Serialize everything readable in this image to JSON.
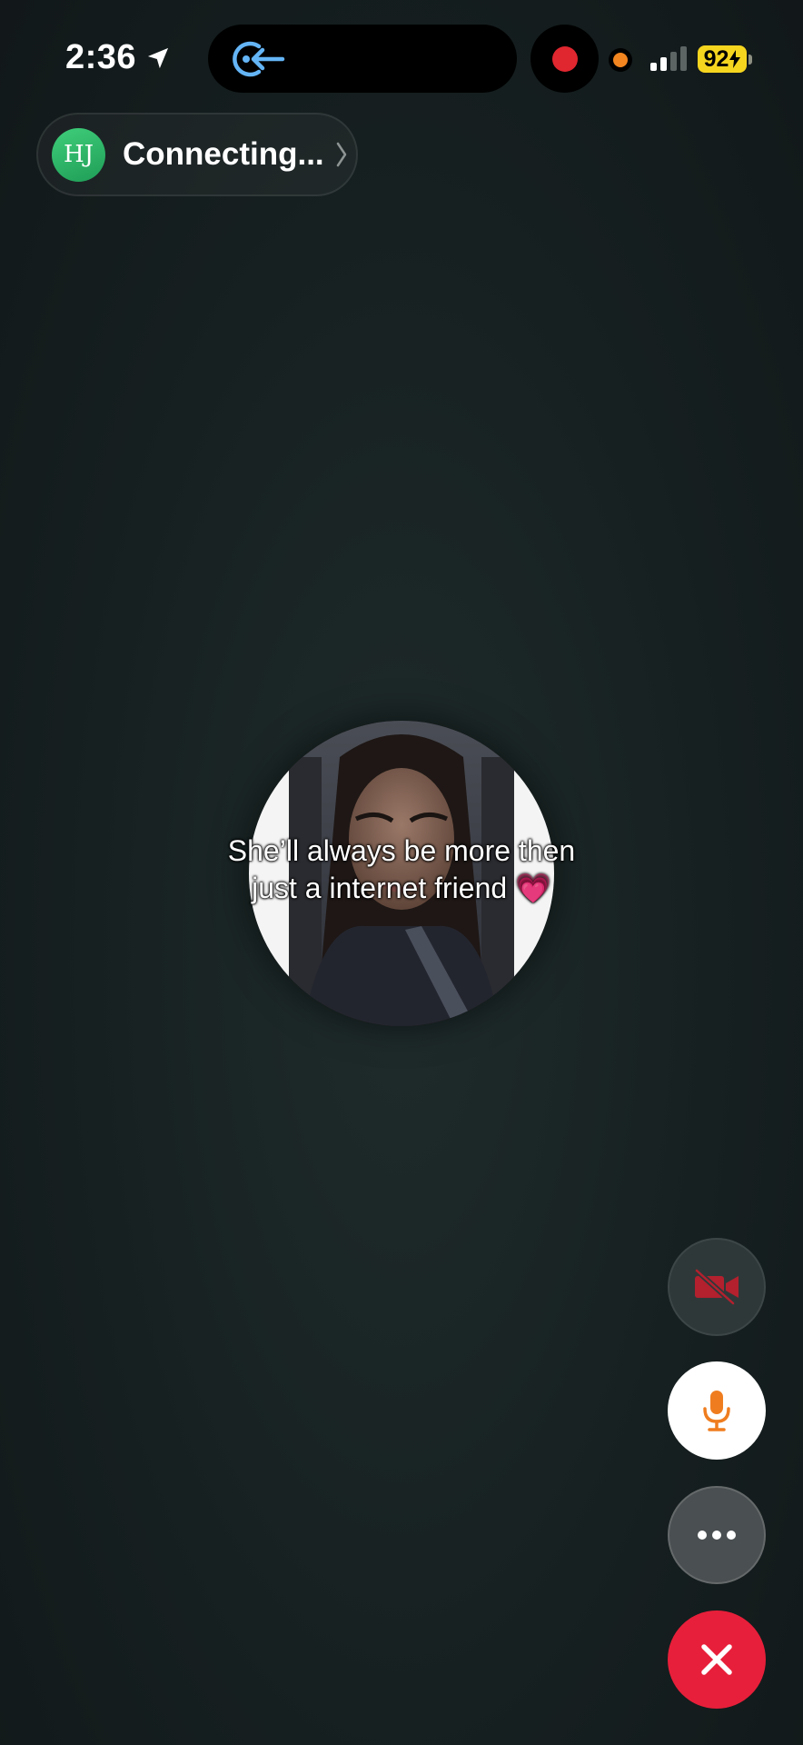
{
  "status_bar": {
    "time": "2:36",
    "battery": "92",
    "location_icon": "location-arrow-icon",
    "island_icon": "call-return-icon",
    "recording_icon": "record-dot-icon",
    "colors": {
      "battery": "#f6d51f",
      "record": "#e0262f",
      "privacy_dot": "#f2851f",
      "island_icon": "#64b5f6"
    }
  },
  "call": {
    "avatar_initials": "HJ",
    "status": "Connecting...",
    "chevron_icon": "chevron-right-icon",
    "colors": {
      "avatar": "#2fb868"
    }
  },
  "contact_photo": {
    "caption_line1": "She’ll always be more then",
    "caption_line2": "just a internet friend",
    "caption_emoji": "💗"
  },
  "controls": {
    "video": {
      "icon": "video-off-icon",
      "state": "off",
      "color": "#b3202e"
    },
    "mic": {
      "icon": "microphone-icon",
      "state": "on",
      "color": "#ef7d1f"
    },
    "more": {
      "icon": "more-icon"
    },
    "end_call": {
      "icon": "close-icon",
      "color": "#e81f3a"
    }
  }
}
